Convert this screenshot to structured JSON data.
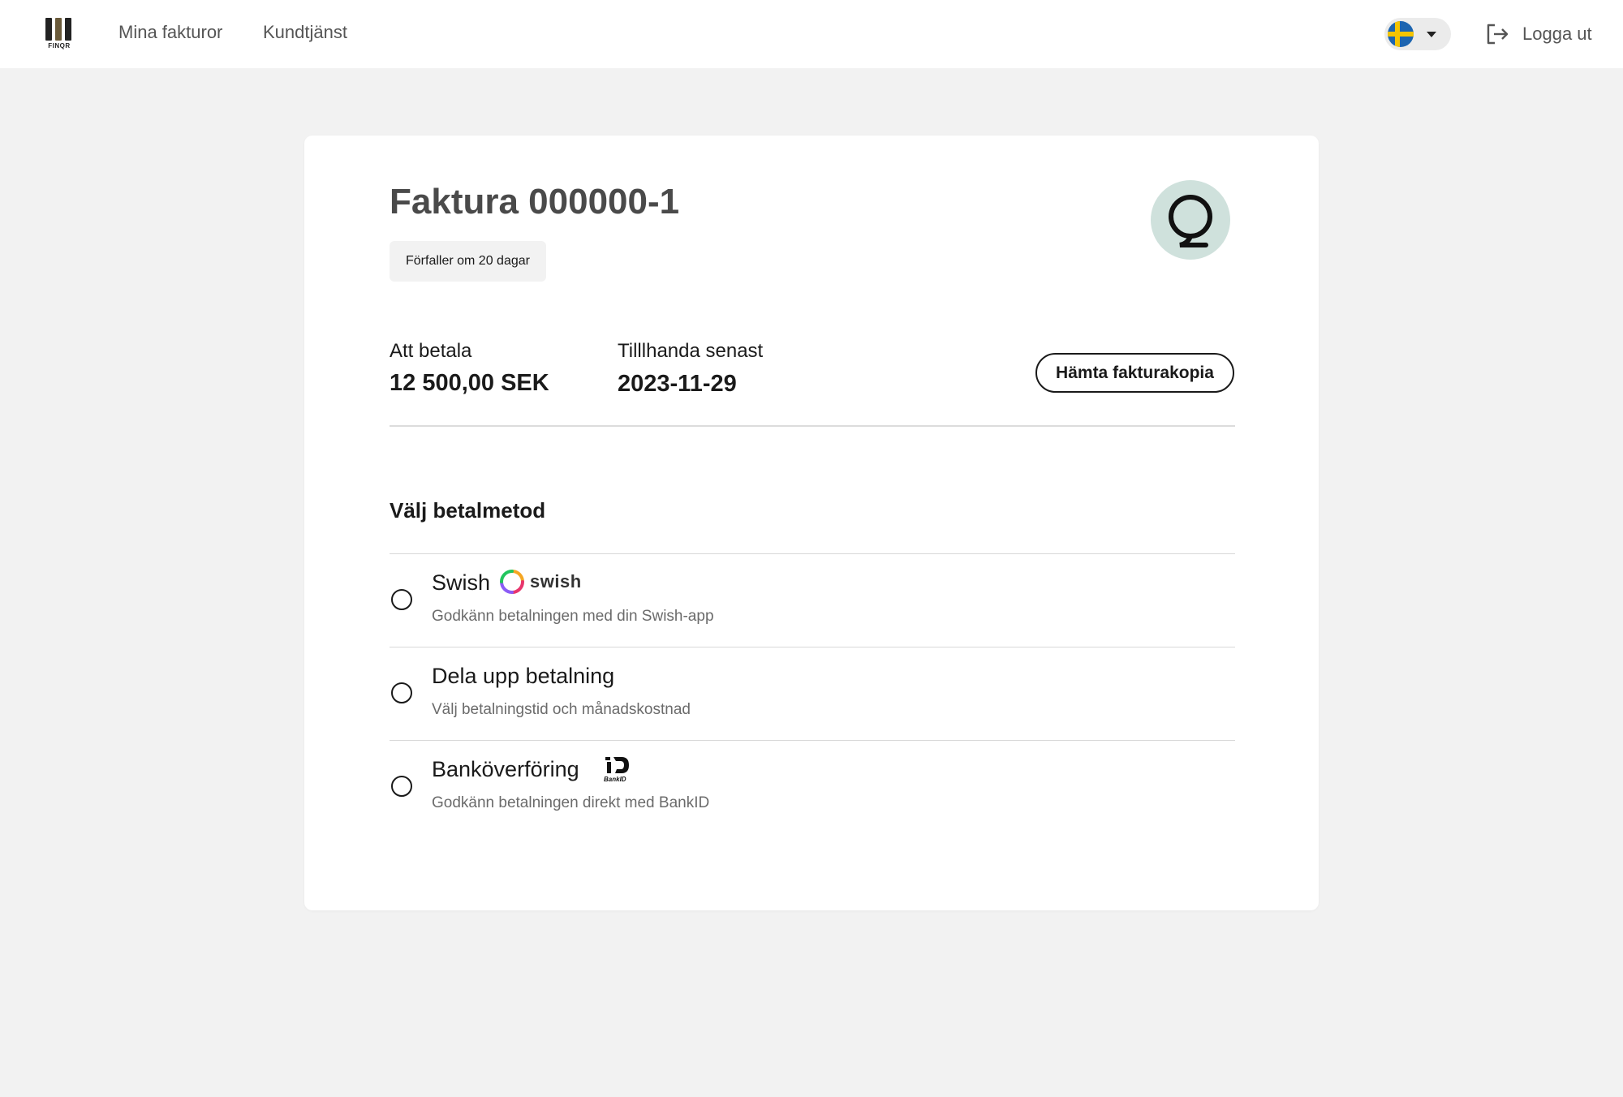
{
  "header": {
    "logo_text": "FINQR",
    "nav": {
      "invoices": "Mina fakturor",
      "support": "Kundtjänst"
    },
    "language_icon": "sweden-flag-icon",
    "logout_label": "Logga ut"
  },
  "invoice": {
    "title": "Faktura 000000-1",
    "due_badge": "Förfaller om 20 dagar",
    "amount_label": "Att betala",
    "amount_value": "12 500,00 SEK",
    "date_label": "Tilllhanda senast",
    "date_value": "2023-11-29",
    "copy_button": "Hämta fakturakopia"
  },
  "payment": {
    "section_title": "Välj betalmetod",
    "methods": [
      {
        "title": "Swish",
        "subtitle": "Godkänn betalningen med din Swish-app",
        "logo": "swish",
        "logo_text": "swish"
      },
      {
        "title": "Dela upp betalning",
        "subtitle": "Välj betalningstid och månadskostnad"
      },
      {
        "title": "Banköverföring",
        "subtitle": "Godkänn betalningen direkt med BankID",
        "logo": "bankid",
        "logo_text": "BankID"
      }
    ]
  },
  "colors": {
    "page_bg": "#f2f2f2",
    "card_bg": "#ffffff",
    "merchant_logo_bg": "#cfe1dc",
    "flag_blue": "#1c64b0",
    "flag_yellow": "#f5c400"
  }
}
